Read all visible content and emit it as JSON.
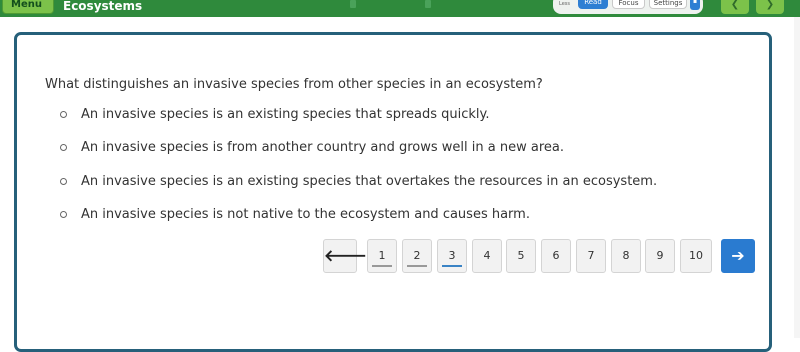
{
  "header": {
    "menu_label": "Menu",
    "title": "Ecosystems",
    "tools": {
      "less_label": "Less",
      "read_label": "Read",
      "focus_label": "Focus",
      "settings_label": "Settings"
    },
    "nav_prev_icon": "chevron-left-icon",
    "nav_next_icon": "chevron-right-icon"
  },
  "question": {
    "prompt": "What distinguishes an invasive species from other species in an ecosystem?",
    "choices": [
      "An invasive species is an existing species that spreads quickly.",
      "An invasive species is from another country and grows well in a new area.",
      "An invasive species is an existing species that overtakes the resources in an ecosystem.",
      "An invasive species is not native to the ecosystem and causes harm."
    ]
  },
  "pagination": {
    "back_glyph": "🡐",
    "forward_glyph": "➔",
    "pages": [
      "1",
      "2",
      "3",
      "4",
      "5",
      "6",
      "7",
      "8",
      "9",
      "10"
    ],
    "current_page": "3"
  },
  "colors": {
    "header_green": "#2f8a3c",
    "card_border": "#26607a",
    "accent_blue": "#2a7bd0"
  }
}
